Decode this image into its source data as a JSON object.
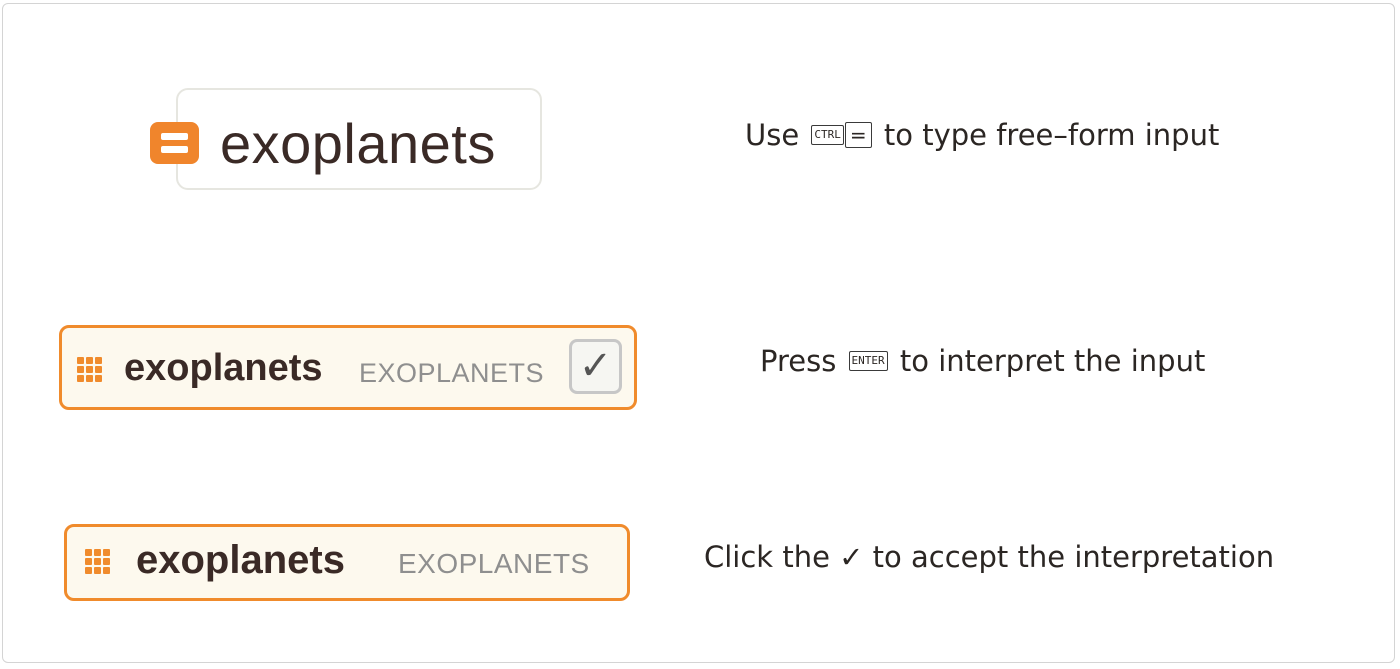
{
  "row1": {
    "input_text": "exoplanets",
    "caption": {
      "prefix": "Use",
      "key_ctrl": "CTRL",
      "key_eq": "=",
      "suffix": "to type free–form input"
    }
  },
  "row2": {
    "input_text": "exoplanets",
    "interpretation": "EXOPLANETS",
    "check_glyph": "✓",
    "caption": {
      "prefix": "Press",
      "key_enter": "ENTER",
      "suffix": "to interpret the input"
    }
  },
  "row3": {
    "input_text": "exoplanets",
    "interpretation": "EXOPLANETS",
    "caption": {
      "prefix": "Click the",
      "check_glyph": "✓",
      "suffix": "to accept the interpretation"
    }
  },
  "colors": {
    "accent_orange": "#f08b2c",
    "input_background": "#fdf9ee",
    "text_dark": "#3a2a26",
    "interpretation_gray": "#8f8f8f"
  },
  "icons": {
    "freeform_badge": "free-form-input-icon",
    "interpreted_badge": "grid-dots-icon",
    "accept": "checkmark-icon"
  }
}
